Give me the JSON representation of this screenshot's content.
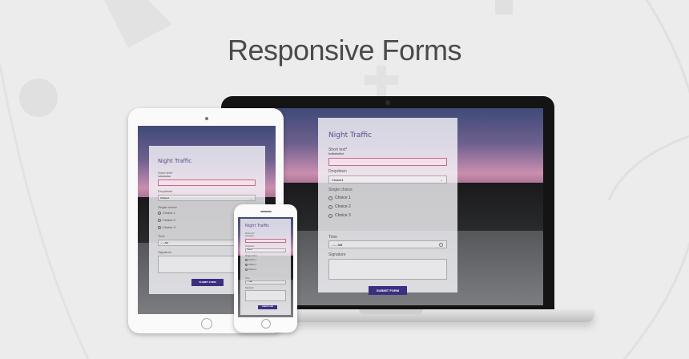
{
  "page": {
    "title": "Responsive Forms"
  },
  "form": {
    "title": "Night Traffic",
    "short_text_label": "Short text*",
    "short_text_value": "fsdfsdfsdfsd",
    "dropdown_label": "Dropdown",
    "dropdown_value": "Choice1",
    "single_choice_label": "Single choice",
    "choices": [
      "Choice 1",
      "Choice 2",
      "Choice 3"
    ],
    "time_label": "Time",
    "time_value": "--:-- AM",
    "signature_label": "Signature",
    "submit_label": "SUBMIT FORM"
  },
  "colors": {
    "accent": "#3c2f80",
    "title": "#5b4b8a",
    "background": "#ececec"
  },
  "devices": [
    "laptop",
    "tablet",
    "phone"
  ]
}
